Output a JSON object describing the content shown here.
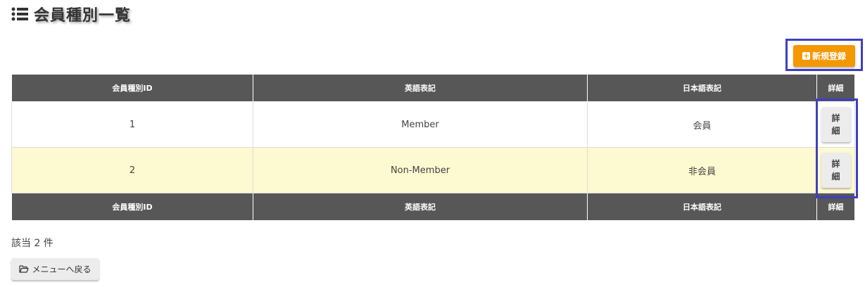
{
  "page": {
    "title": "会員種別一覧",
    "title_icon": "list-icon"
  },
  "toolbar": {
    "new_label": "新規登録",
    "new_icon": "plus-square-icon",
    "accent_color": "#f39800"
  },
  "table": {
    "headers": [
      "会員種別ID",
      "英語表記",
      "日本語表記",
      "詳細"
    ],
    "rows": [
      {
        "id": "1",
        "english": "Member",
        "japanese": "会員",
        "detail_label": "詳細"
      },
      {
        "id": "2",
        "english": "Non-Member",
        "japanese": "非会員",
        "detail_label": "詳細"
      }
    ],
    "header_bg": "#575757",
    "alt_row_bg": "#fdf9d0"
  },
  "footer": {
    "count_text": "該当 2 件",
    "back_label": "メニューへ戻る",
    "back_icon": "folder-open-icon"
  }
}
